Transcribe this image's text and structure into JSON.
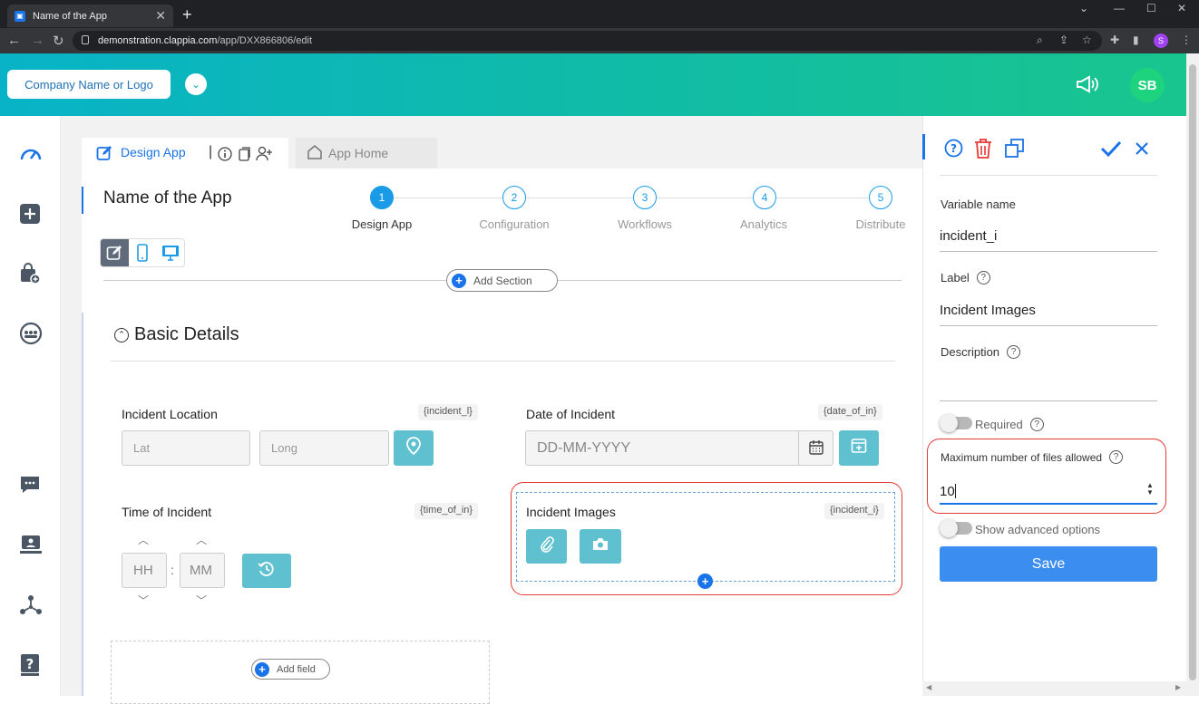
{
  "browser": {
    "tab_title": "Name of the App",
    "url_host": "demonstration.clappia.com",
    "url_path": "/app/DXX866806/edit",
    "profile_initial": "S"
  },
  "header": {
    "logo_label": "Company Name or Logo",
    "avatar_initials": "SB"
  },
  "tabs": {
    "design": "Design App",
    "home": "App Home"
  },
  "app": {
    "title": "Name of the App",
    "steps": [
      {
        "num": "1",
        "label": "Design App"
      },
      {
        "num": "2",
        "label": "Configuration"
      },
      {
        "num": "3",
        "label": "Workflows"
      },
      {
        "num": "4",
        "label": "Analytics"
      },
      {
        "num": "5",
        "label": "Distribute"
      }
    ],
    "add_section": "Add Section",
    "section_title": "Basic Details",
    "add_field": "Add field"
  },
  "fields": {
    "location": {
      "label": "Incident Location",
      "var": "{incident_l}",
      "lat": "Lat",
      "long": "Long"
    },
    "date": {
      "label": "Date of Incident",
      "var": "{date_of_in}",
      "placeholder": "DD-MM-YYYY"
    },
    "time": {
      "label": "Time of Incident",
      "var": "{time_of_in}",
      "hh": "HH",
      "sep": ":",
      "mm": "MM"
    },
    "images": {
      "label": "Incident Images",
      "var": "{incident_i}"
    }
  },
  "panel": {
    "variable_name_label": "Variable name",
    "variable_name_value": "incident_i",
    "label_label": "Label",
    "label_value": "Incident Images",
    "description_label": "Description",
    "required_label": "Required",
    "max_files_label": "Maximum number of files allowed",
    "max_files_value": "10",
    "advanced_label": "Show advanced options",
    "save_label": "Save"
  },
  "colors": {
    "accent": "#1a73e8",
    "teal_button": "#5fc0cf",
    "highlight": "#e53935",
    "save": "#3b8ef0"
  }
}
